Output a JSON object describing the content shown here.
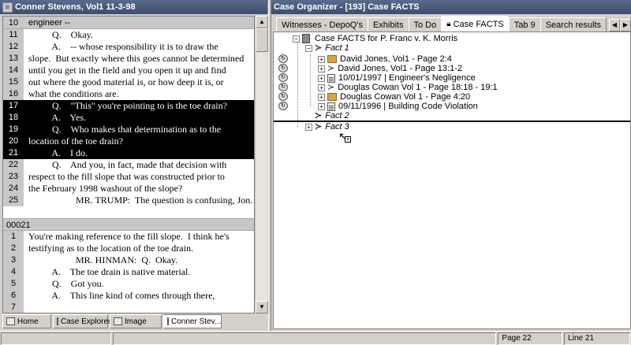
{
  "left": {
    "title": "Conner Stevens, Vol1 11-3-98",
    "page1": {
      "first_line_num": "10",
      "first_line_text": "engineer --",
      "lines": [
        {
          "n": "11",
          "t": "          Q.    Okay.",
          "hl": false
        },
        {
          "n": "12",
          "t": "          A.    -- whose responsibility it is to draw the",
          "hl": false
        },
        {
          "n": "13",
          "t": "slope.  But exactly where this goes cannot be determined",
          "hl": false
        },
        {
          "n": "14",
          "t": "until you get in the field and you open it up and find",
          "hl": false
        },
        {
          "n": "15",
          "t": "out where the good material is, or how deep it is, or",
          "hl": false
        },
        {
          "n": "16",
          "t": "what the conditions are.",
          "hl": false
        },
        {
          "n": "17",
          "t": "          Q.    \"This\" you're pointing to is the toe drain?",
          "hl": true
        },
        {
          "n": "18",
          "t": "          A.    Yes.",
          "hl": true
        },
        {
          "n": "19",
          "t": "          Q.    Who makes that determination as to the",
          "hl": true
        },
        {
          "n": "20",
          "t": "location of the toe drain?",
          "hl": true
        },
        {
          "n": "21",
          "t": "          A.    I do.",
          "hl": true
        },
        {
          "n": "22",
          "t": "          Q.    And you, in fact, made that decision with",
          "hl": false
        },
        {
          "n": "23",
          "t": "respect to the fill slope that was constructed prior to",
          "hl": false
        },
        {
          "n": "24",
          "t": "the February 1998 washout of the slope?",
          "hl": false
        },
        {
          "n": "25",
          "t": "                    MR. TRUMP:  The question is confusing, Jon.",
          "hl": false
        }
      ]
    },
    "page2": {
      "header": "00021",
      "lines": [
        {
          "n": "1",
          "t": "You're making reference to the fill slope.  I think he's",
          "hl": false
        },
        {
          "n": "2",
          "t": "testifying as to the location of the toe drain.",
          "hl": false
        },
        {
          "n": "3",
          "t": "                    MR. HINMAN:  Q.  Okay.",
          "hl": false
        },
        {
          "n": "4",
          "t": "          A.    The toe drain is native material.",
          "hl": false
        },
        {
          "n": "5",
          "t": "          Q.    Got you.",
          "hl": false
        },
        {
          "n": "6",
          "t": "          A.    This line kind of comes through there,",
          "hl": false
        },
        {
          "n": "7",
          "t": "",
          "hl": false
        }
      ]
    },
    "tabs": [
      {
        "label": "Home"
      },
      {
        "label": "Case Explorer"
      },
      {
        "label": "Image"
      },
      {
        "label": "Conner Stev..."
      }
    ]
  },
  "right": {
    "title": "Case Organizer - [193] Case FACTS",
    "tabs": [
      {
        "label": "Witnesses - DepoQ's"
      },
      {
        "label": "Exhibits"
      },
      {
        "label": "To Do"
      },
      {
        "label": "Case FACTS"
      },
      {
        "label": "Tab 9"
      },
      {
        "label": "Search results"
      }
    ],
    "tree": {
      "root": "Case FACTS for P. Franc v. K. Morris",
      "fact1": "Fact 1",
      "fact1_items": [
        {
          "label": "David Jones, Vol1 - Page 2:4",
          "icon": "folder-icon"
        },
        {
          "label": "David Jones, Vol1 - Page 13:1-2",
          "icon": "arrow-icon"
        },
        {
          "label": "10/01/1997 | Engineer's Negligence",
          "icon": "document-icon"
        },
        {
          "label": "Douglas Cowan Vol 1 - Page 18:18 - 19:1",
          "icon": "arrow-icon"
        },
        {
          "label": "Douglas Cowan Vol 1 - Page 4:20",
          "icon": "folder-icon"
        },
        {
          "label": "09/11/1996 | Building Code Violation",
          "icon": "document-icon"
        }
      ],
      "fact2": "Fact 2",
      "fact3": "Fact 3"
    }
  },
  "status": {
    "page": "Page 22",
    "line": "Line 21"
  }
}
